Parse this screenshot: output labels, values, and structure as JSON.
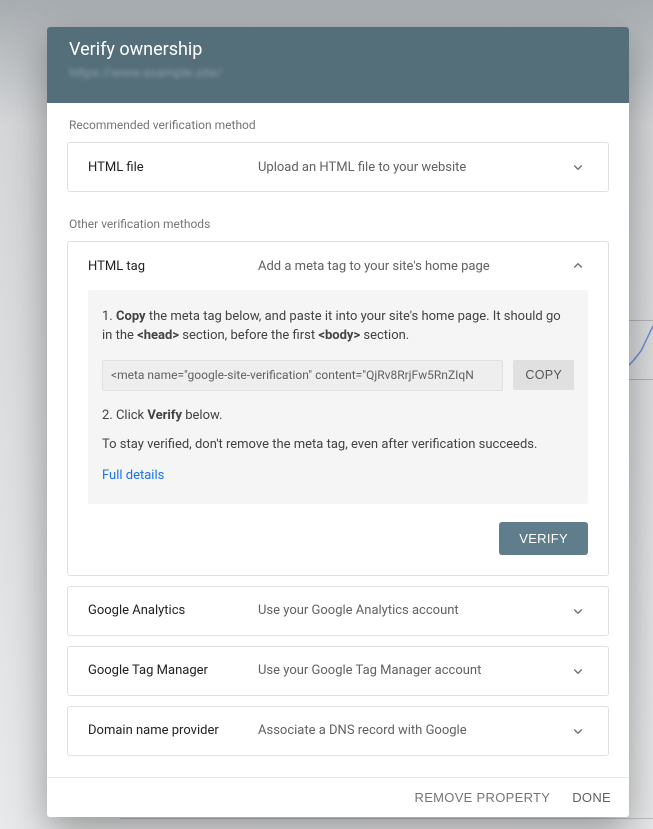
{
  "background": {
    "url_fragment": "ilism.org"
  },
  "modal": {
    "title": "Verify ownership",
    "subtitle_blurred": "https://www.example.site/"
  },
  "sections": {
    "recommended_label": "Recommended verification method",
    "other_label": "Other verification methods"
  },
  "methods": {
    "html_file": {
      "name": "HTML file",
      "desc": "Upload an HTML file to your website"
    },
    "html_tag": {
      "name": "HTML tag",
      "desc": "Add a meta tag to your site's home page",
      "step1_prefix": "1. ",
      "step1_bold": "Copy",
      "step1_mid": " the meta tag below, and paste it into your site's home page. It should go in the ",
      "step1_code1": "<head>",
      "step1_mid2": " section, before the first ",
      "step1_code2": "<body>",
      "step1_suffix": " section.",
      "meta_snippet": "<meta name=\"google-site-verification\" content=\"QjRv8RrjFw5RnZIqN",
      "copy_label": "COPY",
      "step2_prefix": "2. Click ",
      "step2_bold": "Verify",
      "step2_suffix": " below.",
      "note": "To stay verified, don't remove the meta tag, even after verification succeeds.",
      "full_details": "Full details",
      "verify_label": "VERIFY"
    },
    "analytics": {
      "name": "Google Analytics",
      "desc": "Use your Google Analytics account"
    },
    "tag_manager": {
      "name": "Google Tag Manager",
      "desc": "Use your Google Tag Manager account"
    },
    "dns": {
      "name": "Domain name provider",
      "desc": "Associate a DNS record with Google"
    }
  },
  "footer": {
    "remove": "REMOVE PROPERTY",
    "done": "DONE"
  }
}
